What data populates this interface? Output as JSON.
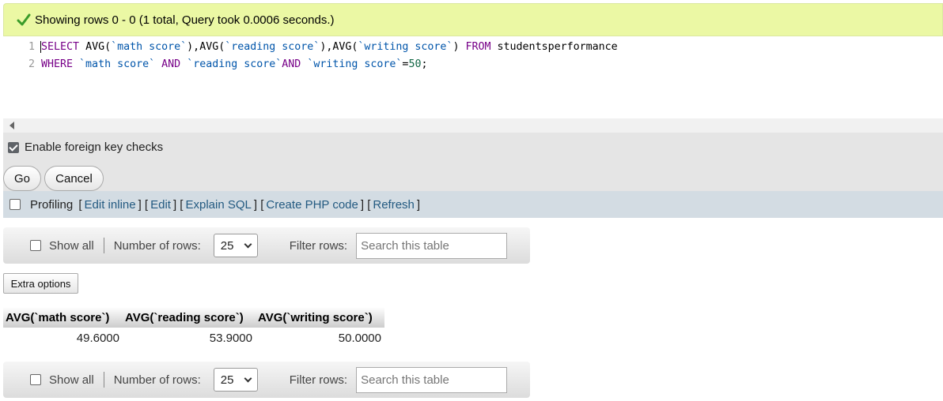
{
  "message": {
    "icon": "check-icon",
    "text": "Showing rows 0 - 0 (1 total, Query took 0.0006 seconds.)"
  },
  "editor": {
    "line_numbers": [
      "1",
      "2"
    ],
    "line1": {
      "kw_select": "SELECT",
      "fn1": "AVG(",
      "col1": "`math score`",
      "p1": "),",
      "fn2": "AVG(",
      "col2": "`reading score`",
      "p2": "),",
      "fn3": "AVG(",
      "col3": "`writing score`",
      "p3": ")",
      "kw_from": "FROM",
      "table": "studentsperformance"
    },
    "line2": {
      "kw_where": "WHERE",
      "col1": "`math score`",
      "kw_and1": "AND",
      "col2": "`reading score`",
      "kw_and2": "AND",
      "col3": "`writing score`",
      "op": "=",
      "num": "50",
      "end": ";"
    }
  },
  "options": {
    "foreign_key_checks_label": "Enable foreign key checks",
    "foreign_key_checks_checked": true
  },
  "buttons": {
    "go": "Go",
    "cancel": "Cancel",
    "extra_options": "Extra options"
  },
  "profiling": {
    "label": "Profiling",
    "links": [
      "Edit inline",
      "Edit",
      "Explain SQL",
      "Create PHP code",
      "Refresh"
    ]
  },
  "navigation": {
    "show_all_label": "Show all",
    "number_of_rows_label": "Number of rows:",
    "rows_value": "25",
    "filter_label": "Filter rows:",
    "search_placeholder": "Search this table"
  },
  "results": {
    "columns": [
      "AVG(`math score`)",
      "AVG(`reading score`)",
      "AVG(`writing score`)"
    ],
    "rows": [
      [
        "49.6000",
        "53.9000",
        "50.0000"
      ]
    ]
  }
}
